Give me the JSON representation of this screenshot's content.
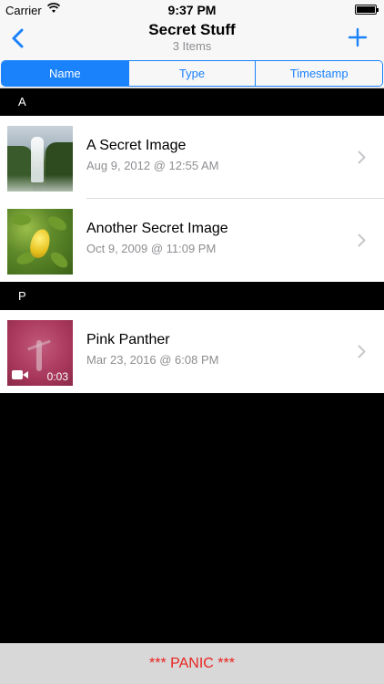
{
  "status_bar": {
    "carrier": "Carrier",
    "time": "9:37 PM",
    "wifi_icon": "wifi-icon",
    "battery_icon": "battery-icon"
  },
  "nav": {
    "title": "Secret Stuff",
    "subtitle": "3 Items",
    "back_icon": "chevron-left-icon",
    "add_icon": "plus-icon",
    "accent": "#1a82fb"
  },
  "sort_tabs": [
    {
      "label": "Name",
      "selected": true
    },
    {
      "label": "Type",
      "selected": false
    },
    {
      "label": "Timestamp",
      "selected": false
    }
  ],
  "sections": [
    {
      "header": "A",
      "items": [
        {
          "name": "A Secret Image",
          "date": "Aug 9, 2012 @ 12:55 AM",
          "thumbnail": "waterfall"
        },
        {
          "name": "Another Secret Image",
          "date": "Oct 9, 2009 @ 11:09 PM",
          "thumbnail": "lemon-tree"
        }
      ]
    },
    {
      "header": "P",
      "items": [
        {
          "name": "Pink Panther",
          "date": "Mar 23, 2016 @ 6:08 PM",
          "thumbnail": "pink-video",
          "video_duration": "0:03",
          "video_icon": "video-camera-icon"
        }
      ]
    }
  ],
  "panic_button": {
    "label": "*** PANIC ***",
    "color": "#e8231f"
  }
}
